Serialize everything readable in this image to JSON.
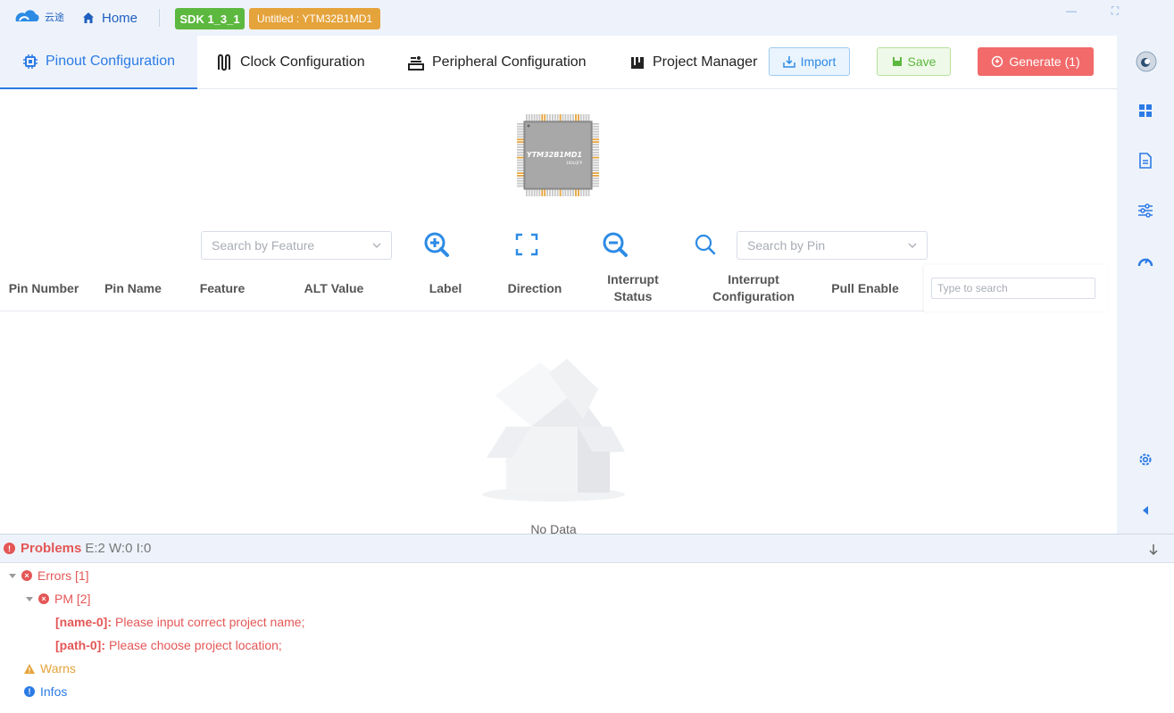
{
  "titlebar": {
    "logo_text": "云途",
    "home_label": "Home",
    "sdk_badge": "SDK 1_3_1",
    "project_badge": "Untitled : YTM32B1MD1",
    "minimize_glyph": "—",
    "maximize_glyph": "⛶"
  },
  "tabs": [
    {
      "label": "Pinout Configuration",
      "icon": "chip-icon",
      "active": true
    },
    {
      "label": "Clock Configuration",
      "icon": "clock-wave-icon",
      "active": false
    },
    {
      "label": "Peripheral Configuration",
      "icon": "peripheral-icon",
      "active": false
    },
    {
      "label": "Project Manager",
      "icon": "project-icon",
      "active": false
    }
  ],
  "toolbar": {
    "import_label": "Import",
    "save_label": "Save",
    "generate_label": "Generate (1)"
  },
  "chip": {
    "label": "YTM32B1MD1",
    "package": "100LQFP"
  },
  "filters": {
    "feature_placeholder": "Search by Feature",
    "pin_placeholder": "Search by Pin"
  },
  "table": {
    "columns": [
      "Pin Number",
      "Pin Name",
      "Feature",
      "ALT Value",
      "Label",
      "Direction",
      "Interrupt Status",
      "Interrupt Configuration",
      "Pull Enable"
    ],
    "search_placeholder": "Type to search",
    "empty_text": "No Data"
  },
  "problems": {
    "title": "Problems",
    "summary": "E:2 W:0 I:0",
    "errors_label": "Errors [1]",
    "pm_label": "PM [2]",
    "items": [
      {
        "key": "[name-0]:",
        "message": "Please input correct project name;"
      },
      {
        "key": "[path-0]:",
        "message": "Please choose project location;"
      }
    ],
    "warns_label": "Warns",
    "infos_label": "Infos"
  },
  "colors": {
    "accent": "#2c7be5",
    "error": "#e45656",
    "warning": "#e5a33b",
    "success": "#5cb83f"
  }
}
